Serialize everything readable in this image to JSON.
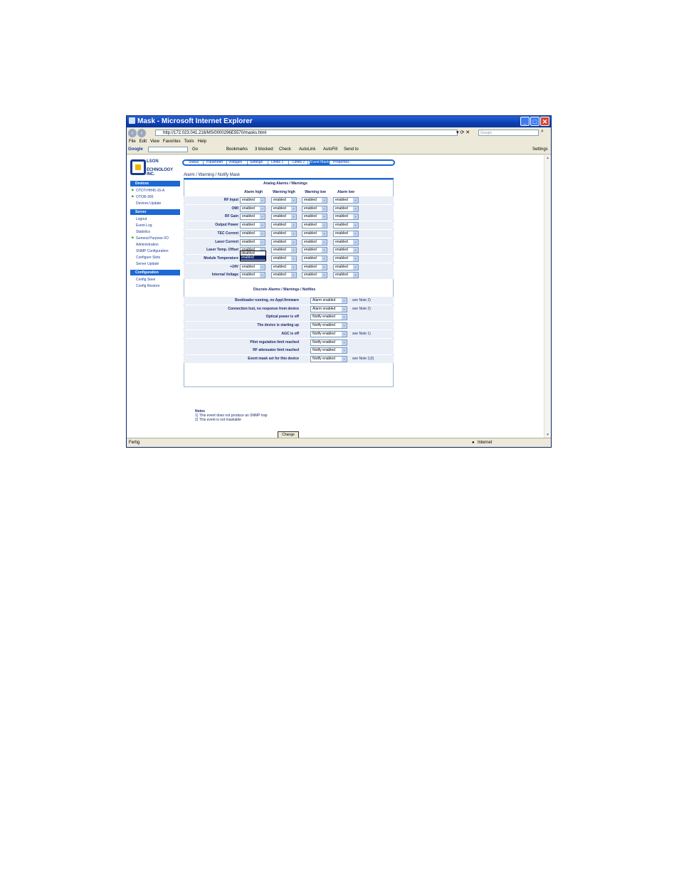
{
  "window": {
    "title": "Mask - Microsoft Internet Explorer"
  },
  "address": {
    "url": "http://172.023.041.216/MS/0000296E5570/masks.html",
    "search_placeholder": "Google"
  },
  "menu": [
    "File",
    "Edit",
    "View",
    "Favorites",
    "Tools",
    "Help"
  ],
  "google_bar": {
    "logo": "Google",
    "items": [
      "Go",
      "Bookmarks",
      "3 blocked",
      "Check",
      "AutoLink",
      "AutoFill",
      "Send to"
    ],
    "settings": "Settings"
  },
  "logo": {
    "line1": "LSON",
    "line2": "ECHNOLOGY INC."
  },
  "sidebar": {
    "sections": [
      {
        "head": "Devices",
        "items": [
          {
            "label": "OTOT-HH45-15-A",
            "flag": true
          },
          {
            "label": "OTOR-300",
            "flag": true
          },
          {
            "label": "Devices Update",
            "flag": false
          }
        ]
      },
      {
        "head": "Server",
        "items": [
          {
            "label": "Logout"
          },
          {
            "label": "Event Log"
          },
          {
            "label": "Statistics"
          },
          {
            "label": "General Purpose I/O",
            "flag": true
          },
          {
            "label": "Administration"
          },
          {
            "label": "SNMP Configuration"
          },
          {
            "label": "Configure Slots"
          },
          {
            "label": "Server Update"
          }
        ]
      },
      {
        "head": "Configuration",
        "items": [
          {
            "label": "Config Save"
          },
          {
            "label": "Config Restore"
          }
        ]
      }
    ]
  },
  "tabs": [
    {
      "label": "Status"
    },
    {
      "label": "Parameter"
    },
    {
      "label": "Voltages"
    },
    {
      "label": "Settings"
    },
    {
      "label": "Limits 1"
    },
    {
      "label": "Limits 2"
    },
    {
      "label": "Event Mask",
      "active": true
    },
    {
      "label": "Properties"
    }
  ],
  "page_heading": "Alarm / Warning / Notify Mask",
  "analog": {
    "title": "Analog Alarms / Warnings",
    "columns": [
      "Alarm high",
      "Warning high",
      "Warning low",
      "Alarm low"
    ],
    "rows": [
      {
        "label": "RF Input",
        "values": [
          "enabled",
          "enabled",
          "enabled",
          "enabled"
        ]
      },
      {
        "label": "OMI",
        "values": [
          "enabled",
          "enabled",
          "enabled",
          "enabled"
        ]
      },
      {
        "label": "RF Gain",
        "values": [
          "enabled",
          "enabled",
          "enabled",
          "enabled"
        ]
      },
      {
        "label": "Output Power",
        "values": [
          "enabled",
          "enabled",
          "enabled",
          "enabled"
        ]
      },
      {
        "label": "TEC Current",
        "values": [
          "enabled",
          "enabled",
          "enabled",
          "enabled"
        ]
      },
      {
        "label": "Laser Current",
        "values": [
          "enabled",
          "enabled",
          "enabled",
          "enabled"
        ]
      },
      {
        "label": "Laser Temp. Offset",
        "values": [
          "enabled",
          "enabled",
          "enabled",
          "enabled"
        ]
      },
      {
        "label": "Module Temperature",
        "values": [
          "enabled",
          "enabled",
          "enabled",
          "enabled"
        ]
      },
      {
        "label": "+24V",
        "values": [
          "enabled",
          "enabled",
          "enabled",
          "enabled"
        ]
      },
      {
        "label": "Internal Voltage",
        "values": [
          "enabled",
          "enabled",
          "enabled",
          "enabled"
        ]
      }
    ],
    "open_dropdown": {
      "options": [
        "disabled",
        "enabled"
      ],
      "highlighted": "enabled"
    }
  },
  "discrete": {
    "title": "Discrete Alarms / Warnings / Notifies",
    "rows": [
      {
        "label": "Bootloader running, no Appl.firmware",
        "value": "Alarm enabled",
        "note": "see Note 2)"
      },
      {
        "label": "Connection lost, no response from device",
        "value": "Alarm enabled",
        "note": "see Note 2)"
      },
      {
        "label": "Optical power is off",
        "value": "Notify enabled",
        "note": ""
      },
      {
        "label": "The device is starting up",
        "value": "Notify enabled",
        "note": ""
      },
      {
        "label": "AGC is off",
        "value": "Notify enabled",
        "note": "see Note 1)"
      },
      {
        "label": "Pilot regulation limit reached",
        "value": "Notify enabled",
        "note": ""
      },
      {
        "label": "RF attenuator limit reached",
        "value": "Notify enabled",
        "note": ""
      },
      {
        "label": "Event mask set for this device",
        "value": "Notify enabled",
        "note": "see Note 1)2)"
      }
    ]
  },
  "notes": {
    "head": "Notes",
    "lines": [
      "1) This event does not produce an SNMP trap",
      "2) This event is not maskable"
    ]
  },
  "change_button": "Change",
  "statusbar": {
    "left": "Fertig",
    "zone": "Internet"
  }
}
